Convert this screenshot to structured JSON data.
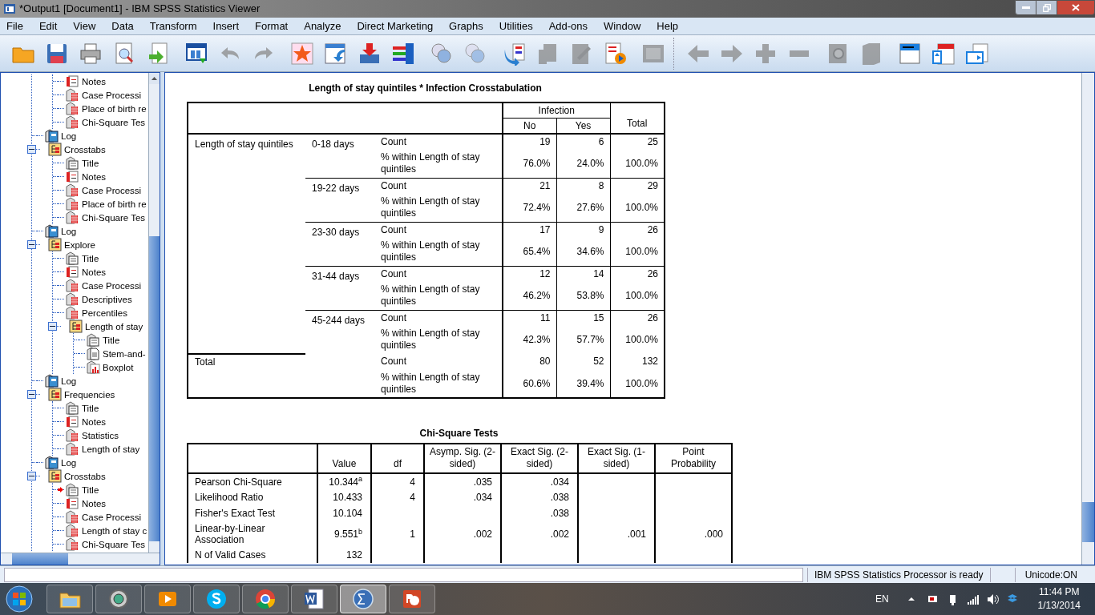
{
  "window": {
    "title": "*Output1 [Document1] - IBM SPSS Statistics Viewer"
  },
  "menu": [
    "File",
    "Edit",
    "View",
    "Data",
    "Transform",
    "Insert",
    "Format",
    "Analyze",
    "Direct Marketing",
    "Graphs",
    "Utilities",
    "Add-ons",
    "Window",
    "Help"
  ],
  "toolbar": [
    {
      "kind": "open",
      "disabled": false
    },
    {
      "kind": "save",
      "disabled": false
    },
    {
      "kind": "print",
      "disabled": false
    },
    {
      "kind": "preview",
      "disabled": false
    },
    {
      "kind": "export",
      "disabled": false
    },
    {
      "kind": "recall",
      "disabled": false
    },
    {
      "kind": "undo",
      "disabled": true
    },
    {
      "kind": "redo",
      "disabled": true
    },
    {
      "kind": "star",
      "disabled": false
    },
    {
      "kind": "goto",
      "disabled": false
    },
    {
      "kind": "insert",
      "disabled": false
    },
    {
      "kind": "variables",
      "disabled": false
    },
    {
      "kind": "sets",
      "disabled": false
    },
    {
      "kind": "sets",
      "disabled": true
    },
    {
      "kind": "script",
      "disabled": false
    },
    {
      "kind": "promote",
      "disabled": true
    },
    {
      "kind": "edit",
      "disabled": true
    },
    {
      "kind": "run",
      "disabled": false
    },
    {
      "kind": "frame",
      "disabled": true
    },
    {
      "kind": "back",
      "disabled": true
    },
    {
      "kind": "forward",
      "disabled": true
    },
    {
      "kind": "expand",
      "disabled": true
    },
    {
      "kind": "collapse",
      "disabled": true
    },
    {
      "kind": "zoom",
      "disabled": true
    },
    {
      "kind": "hide",
      "disabled": true
    },
    {
      "kind": "heading",
      "disabled": false
    },
    {
      "kind": "newtitle",
      "disabled": false
    },
    {
      "kind": "newtext",
      "disabled": false
    }
  ],
  "tree": [
    {
      "kind": "hidden",
      "children": [
        {
          "kind": "notes",
          "label": "Notes",
          "selected": false
        },
        {
          "kind": "table",
          "label": "Case Processi",
          "selected": false
        },
        {
          "kind": "table",
          "label": "Place of birth re",
          "selected": false
        },
        {
          "kind": "table",
          "label": "Chi-Square Tes",
          "selected": false
        }
      ]
    },
    {
      "kind": "log",
      "label": "Log",
      "selected": false
    },
    {
      "kind": "folder",
      "label": "Crosstabs",
      "expanded": true,
      "selected": false,
      "children": [
        {
          "kind": "title",
          "label": "Title",
          "selected": false
        },
        {
          "kind": "notes",
          "label": "Notes",
          "selected": false
        },
        {
          "kind": "table",
          "label": "Case Processi",
          "selected": false
        },
        {
          "kind": "table",
          "label": "Place of birth re",
          "selected": false
        },
        {
          "kind": "table",
          "label": "Chi-Square Tes",
          "selected": false
        }
      ]
    },
    {
      "kind": "log",
      "label": "Log",
      "selected": false
    },
    {
      "kind": "folder",
      "label": "Explore",
      "expanded": true,
      "selected": false,
      "children": [
        {
          "kind": "title",
          "label": "Title",
          "selected": false
        },
        {
          "kind": "notes",
          "label": "Notes",
          "selected": false
        },
        {
          "kind": "table",
          "label": "Case Processi",
          "selected": false
        },
        {
          "kind": "table",
          "label": "Descriptives",
          "selected": false
        },
        {
          "kind": "table",
          "label": "Percentiles",
          "selected": false
        },
        {
          "kind": "folder",
          "label": "Length of stay",
          "expanded": true,
          "selected": false,
          "children": [
            {
              "kind": "title",
              "label": "Title",
              "selected": false
            },
            {
              "kind": "text",
              "label": "Stem-and-",
              "selected": false
            },
            {
              "kind": "chart",
              "label": "Boxplot",
              "selected": false
            }
          ]
        }
      ]
    },
    {
      "kind": "log",
      "label": "Log",
      "selected": false
    },
    {
      "kind": "folder",
      "label": "Frequencies",
      "expanded": true,
      "selected": false,
      "children": [
        {
          "kind": "title",
          "label": "Title",
          "selected": false
        },
        {
          "kind": "notes",
          "label": "Notes",
          "selected": false
        },
        {
          "kind": "table",
          "label": "Statistics",
          "selected": false
        },
        {
          "kind": "table",
          "label": "Length of stay",
          "selected": false
        }
      ]
    },
    {
      "kind": "log",
      "label": "Log",
      "selected": false
    },
    {
      "kind": "folder",
      "label": "Crosstabs",
      "expanded": true,
      "selected": false,
      "children": [
        {
          "kind": "title",
          "label": "Title",
          "selected": true
        },
        {
          "kind": "notes",
          "label": "Notes",
          "selected": false
        },
        {
          "kind": "table",
          "label": "Case Processi",
          "selected": false
        },
        {
          "kind": "table",
          "label": "Length of stay c",
          "selected": false
        },
        {
          "kind": "table",
          "label": "Chi-Square Tes",
          "selected": false
        }
      ]
    }
  ],
  "crosstab": {
    "title": "Length of stay quintiles * Infection Crosstabulation",
    "col_group": "Infection",
    "columns": [
      "No",
      "Yes"
    ],
    "total_label": "Total",
    "row_var": "Length of stay quintiles",
    "groups": [
      {
        "label": "0-18 days",
        "rows": [
          {
            "stat": "Count",
            "values": [
              "19",
              "6",
              "25"
            ]
          },
          {
            "stat": "% within Length of stay quintiles",
            "values": [
              "76.0%",
              "24.0%",
              "100.0%"
            ]
          }
        ]
      },
      {
        "label": "19-22 days",
        "rows": [
          {
            "stat": "Count",
            "values": [
              "21",
              "8",
              "29"
            ]
          },
          {
            "stat": "% within Length of stay quintiles",
            "values": [
              "72.4%",
              "27.6%",
              "100.0%"
            ]
          }
        ]
      },
      {
        "label": "23-30 days",
        "rows": [
          {
            "stat": "Count",
            "values": [
              "17",
              "9",
              "26"
            ]
          },
          {
            "stat": "% within Length of stay quintiles",
            "values": [
              "65.4%",
              "34.6%",
              "100.0%"
            ]
          }
        ]
      },
      {
        "label": "31-44 days",
        "rows": [
          {
            "stat": "Count",
            "values": [
              "12",
              "14",
              "26"
            ]
          },
          {
            "stat": "% within Length of stay quintiles",
            "values": [
              "46.2%",
              "53.8%",
              "100.0%"
            ]
          }
        ]
      },
      {
        "label": "45-244 days",
        "rows": [
          {
            "stat": "Count",
            "values": [
              "11",
              "15",
              "26"
            ]
          },
          {
            "stat": "% within Length of stay quintiles",
            "values": [
              "42.3%",
              "57.7%",
              "100.0%"
            ]
          }
        ]
      }
    ],
    "total": {
      "label": "Total",
      "rows": [
        {
          "stat": "Count",
          "values": [
            "80",
            "52",
            "132"
          ]
        },
        {
          "stat": "% within Length of stay quintiles",
          "values": [
            "60.6%",
            "39.4%",
            "100.0%"
          ]
        }
      ]
    }
  },
  "chi_square": {
    "title": "Chi-Square Tests",
    "columns": [
      "Value",
      "df",
      "Asymp. Sig. (2-sided)",
      "Exact Sig. (2-sided)",
      "Exact Sig. (1-sided)",
      "Point Probability"
    ],
    "rows": [
      {
        "label": "Pearson Chi-Square",
        "value": "10.344$^{a}$",
        "df": "4",
        "asymp_sig_2": ".035",
        "exact_sig_2": ".034"
      },
      {
        "label": "Likelihood Ratio",
        "value": "10.433",
        "df": "4",
        "asymp_sig_2": ".034",
        "exact_sig_2": ".038"
      },
      {
        "label": "Fisher's Exact Test",
        "value": "10.104",
        "exact_sig_2": ".038"
      },
      {
        "label": "Linear-by-Linear Association",
        "value": "9.551$^{b}$",
        "df": "1",
        "asymp_sig_2": ".002",
        "exact_sig_2": ".002",
        "exact_sig_1": ".001",
        "point_probability": ".000"
      },
      {
        "label": "N of Valid Cases",
        "value": "132"
      }
    ]
  },
  "status_bar": {
    "message": "IBM SPSS Statistics Processor is ready",
    "encoding": "Unicode:ON"
  },
  "taskbar": {
    "apps": [
      {
        "kind": "folder",
        "selected": false
      },
      {
        "kind": "disc",
        "selected": false
      },
      {
        "kind": "media",
        "selected": false
      },
      {
        "kind": "skype",
        "selected": false
      },
      {
        "kind": "chrome",
        "selected": false
      },
      {
        "kind": "word",
        "selected": false
      },
      {
        "kind": "spss",
        "selected": true
      },
      {
        "kind": "powerpoint",
        "selected": false
      }
    ],
    "language": "EN",
    "time": "11:44 PM",
    "date": "1/13/2014"
  }
}
